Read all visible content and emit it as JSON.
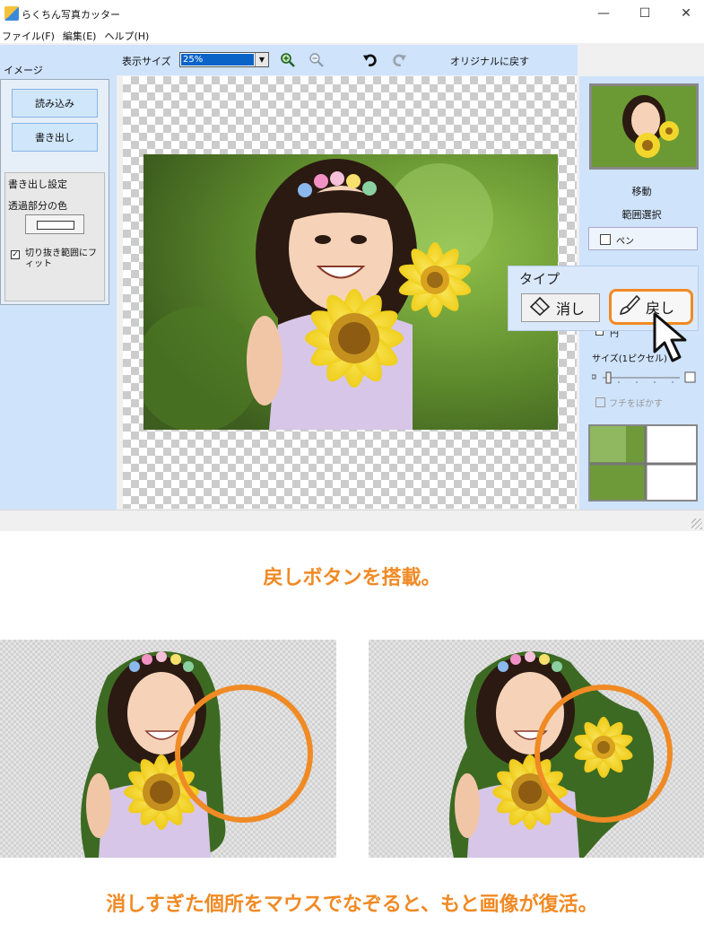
{
  "window": {
    "title": "らくちん写真カッター",
    "controls": {
      "minimize": "—",
      "maximize": "☐",
      "close": "✕"
    }
  },
  "menu": {
    "file": "ファイル(F)",
    "edit": "編集(E)",
    "help": "ヘルプ(H)"
  },
  "toolbar": {
    "display_size_label": "表示サイズ",
    "zoom_value": "25%",
    "zoom_in_icon": "zoom-in-icon",
    "zoom_out_icon": "zoom-out-icon",
    "undo_icon": "undo-icon",
    "redo_icon": "redo-icon",
    "reset_label": "オリジナルに戻す"
  },
  "left_panel": {
    "title": "イメージ",
    "load_button": "読み込み",
    "export_button": "書き出し",
    "export_settings_title": "書き出し設定",
    "transparent_color_label": "透過部分の色",
    "fit_checkbox_label": "切り抜き範囲にフィット",
    "fit_checked": true
  },
  "right_panel": {
    "move_label": "移動",
    "range_select_label": "範囲選択",
    "pen_label": "ペン",
    "circle_label": "円",
    "size_label": "サイズ(1ピクセル)",
    "blur_edge_label": "フチをぼかす"
  },
  "callout": {
    "type_label": "タイプ",
    "erase_button": "消し",
    "restore_button": "戻し"
  },
  "captions": {
    "headline": "戻しボタンを搭載。",
    "description": "消しすぎた個所をマウスでなぞると、もと画像が復活。"
  },
  "colors": {
    "accent_orange": "#f08a24",
    "panel_blue": "#cfe3fb",
    "selection_blue": "#0a64c8"
  }
}
